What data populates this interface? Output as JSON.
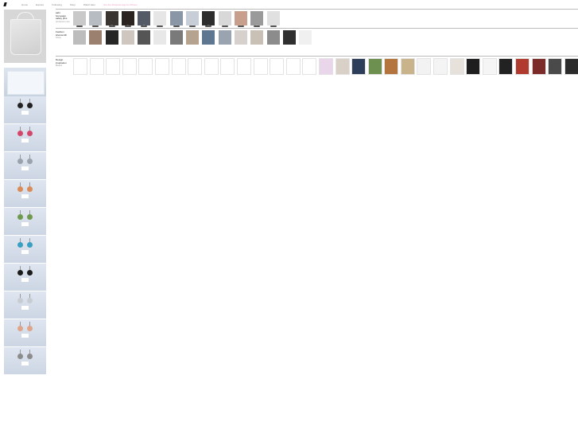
{
  "header": {
    "brand": "Pinterest",
    "nav": [
      "Home",
      "Explore",
      "Following",
      "Shop",
      "Watch later",
      "Get the Pinterest app for iPhone"
    ]
  },
  "sidebar": {
    "items": [
      "tote-bag",
      "shoebox",
      "earrings-black",
      "earrings-pink",
      "earrings-grey",
      "earrings-orange",
      "earrings-green",
      "earrings-teal",
      "earrings-black-2",
      "earrings-clear",
      "earrings-peach",
      "earrings-silver"
    ]
  },
  "sections": [
    {
      "title": "sabi\nhomesign\nsafety pins",
      "subtitle": "pinterest.com",
      "items": [
        {
          "label": "Save",
          "tone": "#c9c9c9"
        },
        {
          "label": "Save",
          "tone": "#b7bcc3"
        },
        {
          "label": "Save",
          "tone": "#3b3531"
        },
        {
          "label": "Save",
          "tone": "#2a2320"
        },
        {
          "label": "Save",
          "tone": "#555b66"
        },
        {
          "label": "Save",
          "tone": "#e6e6e6"
        },
        {
          "label": "Save",
          "tone": "#8a95a5"
        },
        {
          "label": "Save",
          "tone": "#c7ced8"
        },
        {
          "label": "Save",
          "tone": "#2d2d2d"
        },
        {
          "label": "Save",
          "tone": "#d8d8d8"
        },
        {
          "label": "Save",
          "tone": "#c79f8c"
        },
        {
          "label": "Save",
          "tone": "#9a9a9a"
        },
        {
          "label": "Save",
          "tone": "#e0e0e0"
        }
      ]
    },
    {
      "title": "Fashion\nsilversmith",
      "subtitle": "Shop",
      "items": [
        {
          "badge": "",
          "tone": "#bdbdbd"
        },
        {
          "badge": "",
          "tone": "#9b7f6f"
        },
        {
          "badge": "",
          "tone": "#262626"
        },
        {
          "badge": "",
          "tone": "#cfc6bf"
        },
        {
          "badge": "",
          "tone": "#555555"
        },
        {
          "badge": "",
          "tone": "#e8e8e8"
        },
        {
          "badge": "",
          "tone": "#7a7a7a"
        },
        {
          "badge": "",
          "tone": "#b5a38f"
        },
        {
          "badge": "",
          "tone": "#5f7690"
        },
        {
          "badge": "",
          "tone": "#9aa4b0"
        },
        {
          "badge": "",
          "tone": "#d6d1cc"
        },
        {
          "badge": "",
          "tone": "#c9c0b6"
        },
        {
          "badge": "",
          "tone": "#8c8c8c"
        },
        {
          "badge": "",
          "tone": "#2f2f2f"
        },
        {
          "badge": "",
          "tone": "#f0f0f0"
        }
      ]
    },
    {
      "title": "Design\ninspiration",
      "subtitle": "Board",
      "items": [
        {
          "tone": "#ffffff"
        },
        {
          "tone": "#ffffff"
        },
        {
          "tone": "#ffffff"
        },
        {
          "tone": "#ffffff"
        },
        {
          "tone": "#ffffff"
        },
        {
          "tone": "#ffffff"
        },
        {
          "tone": "#ffffff"
        },
        {
          "tone": "#ffffff"
        },
        {
          "tone": "#ffffff"
        },
        {
          "tone": "#ffffff"
        },
        {
          "tone": "#ffffff"
        },
        {
          "tone": "#ffffff"
        },
        {
          "tone": "#ffffff"
        },
        {
          "tone": "#ffffff"
        },
        {
          "tone": "#ffffff"
        },
        {
          "tone": "#e9d6ea"
        },
        {
          "tone": "#d9d0c8"
        },
        {
          "tone": "#2c3e5a"
        },
        {
          "tone": "#6d8f4f"
        },
        {
          "tone": "#b3753d"
        },
        {
          "tone": "#c9b38a"
        },
        {
          "tone": "#f2f2f2"
        },
        {
          "tone": "#f4f4f4"
        },
        {
          "tone": "#e7e1dc"
        },
        {
          "tone": "#1e1e1e"
        },
        {
          "tone": "#f5f5f5"
        },
        {
          "tone": "#222222"
        },
        {
          "tone": "#b03a2e"
        },
        {
          "tone": "#7c2c28"
        },
        {
          "tone": "#4a4a4a"
        },
        {
          "tone": "#2b2b2b"
        }
      ]
    }
  ]
}
